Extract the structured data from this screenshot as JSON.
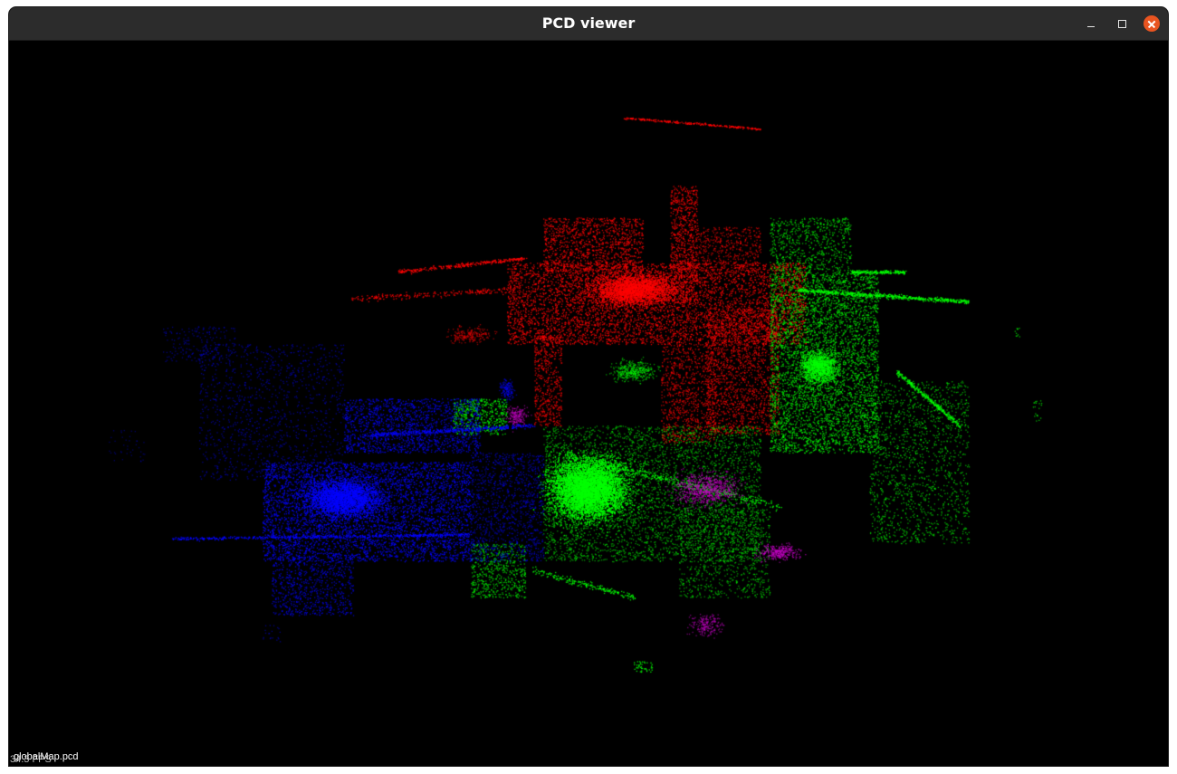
{
  "window": {
    "title": "PCD viewer",
    "controls": {
      "minimize_icon": "minimize-icon",
      "maximize_icon": "maximize-icon",
      "close_icon": "close-icon"
    },
    "close_color": "#e95420",
    "titlebar_color": "#2c2c2c"
  },
  "viewer": {
    "background": "#000000",
    "file_label": "globalMap.pcd",
    "fps_label": "34.3 FPS",
    "point_colors": {
      "red": "#ff0000",
      "green": "#00ff00",
      "blue": "#0000ff",
      "magenta": "#cc00cc"
    }
  }
}
